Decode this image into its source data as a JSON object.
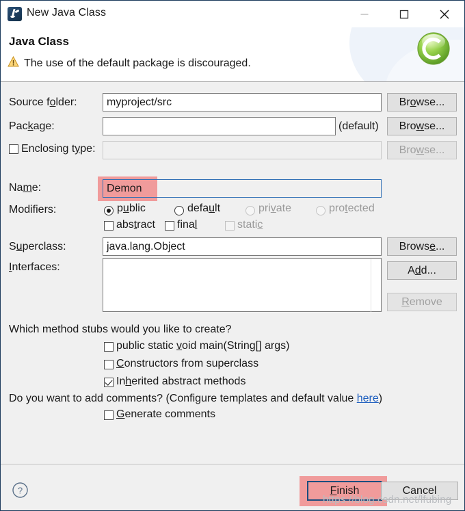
{
  "window": {
    "title": "New Java Class",
    "icon": "java-class-icon",
    "controls": {
      "minimize": "minimize-icon",
      "maximize": "maximize-icon",
      "close": "close-icon"
    }
  },
  "header": {
    "title": "Java Class",
    "warning_icon": "warning-triangle-icon",
    "warning_message": "The use of the default package is discouraged.",
    "banner_logo": "green-c-logo"
  },
  "form": {
    "source_folder": {
      "label_pre": "Source f",
      "label_mnemonic": "o",
      "label_post": "lder:",
      "value": "myproject/src",
      "browse": {
        "pre": "Br",
        "mnemonic": "o",
        "post": "wse..."
      }
    },
    "package": {
      "label_pre": "Pac",
      "label_mnemonic": "k",
      "label_post": "age:",
      "value": "",
      "suffix": "(default)",
      "browse": {
        "pre": "Bro",
        "mnemonic": "w",
        "post": "se..."
      }
    },
    "enclosing_type": {
      "label_pre": "Enclosing t",
      "label_mnemonic": "y",
      "label_post": "pe:",
      "checked": false,
      "value": "",
      "enabled": false,
      "browse": {
        "pre": "Bro",
        "mnemonic": "w",
        "post": "se..."
      }
    },
    "name": {
      "label_pre": "Na",
      "label_mnemonic": "m",
      "label_post": "e:",
      "value": "Demon"
    },
    "modifiers": {
      "label": "Modifiers:",
      "radios": [
        {
          "pre": "p",
          "mnemonic": "u",
          "post": "blic",
          "selected": true,
          "enabled": true
        },
        {
          "pre": "defa",
          "mnemonic": "u",
          "post": "lt",
          "selected": false,
          "enabled": true
        },
        {
          "pre": "pri",
          "mnemonic": "v",
          "post": "ate",
          "selected": false,
          "enabled": false
        },
        {
          "pre": "pro",
          "mnemonic": "t",
          "post": "ected",
          "selected": false,
          "enabled": false
        }
      ],
      "checkboxes": [
        {
          "pre": "abs",
          "mnemonic": "t",
          "post": "ract",
          "checked": false,
          "enabled": true
        },
        {
          "pre": "fina",
          "mnemonic": "l",
          "post": "",
          "checked": false,
          "enabled": true
        },
        {
          "pre": "stati",
          "mnemonic": "c",
          "post": "",
          "checked": false,
          "enabled": false
        }
      ]
    },
    "superclass": {
      "label_pre": "S",
      "label_mnemonic": "u",
      "label_post": "perclass:",
      "value": "java.lang.Object",
      "browse": {
        "pre": "Brows",
        "mnemonic": "e",
        "post": "..."
      }
    },
    "interfaces": {
      "label_pre": "",
      "label_mnemonic": "I",
      "label_post": "nterfaces:",
      "items": [],
      "add": {
        "pre": "A",
        "mnemonic": "d",
        "post": "d..."
      },
      "remove": {
        "pre": "",
        "mnemonic": "R",
        "post": "emove",
        "enabled": false
      }
    },
    "method_stubs": {
      "question": "Which method stubs would you like to create?",
      "options": [
        {
          "pre": "public static ",
          "mnemonic": "v",
          "post": "oid main(String[] args)",
          "checked": false
        },
        {
          "pre": "",
          "mnemonic": "C",
          "post": "onstructors from superclass",
          "checked": false
        },
        {
          "pre": "In",
          "mnemonic": "h",
          "post": "erited abstract methods",
          "checked": true
        }
      ]
    },
    "comments": {
      "question_pre": "Do you want to add comments? (Configure templates and default value ",
      "link": "here",
      "question_post": ")",
      "option": {
        "pre": "",
        "mnemonic": "G",
        "post": "enerate comments",
        "checked": false
      }
    }
  },
  "footer": {
    "help_icon": "help-question-icon",
    "finish": {
      "pre": "",
      "mnemonic": "F",
      "post": "inish"
    },
    "cancel": "Cancel"
  },
  "annotations": {
    "highlight_color": "#ef8e8e",
    "watermark": "https://blog.csdn.net/lfubing"
  }
}
